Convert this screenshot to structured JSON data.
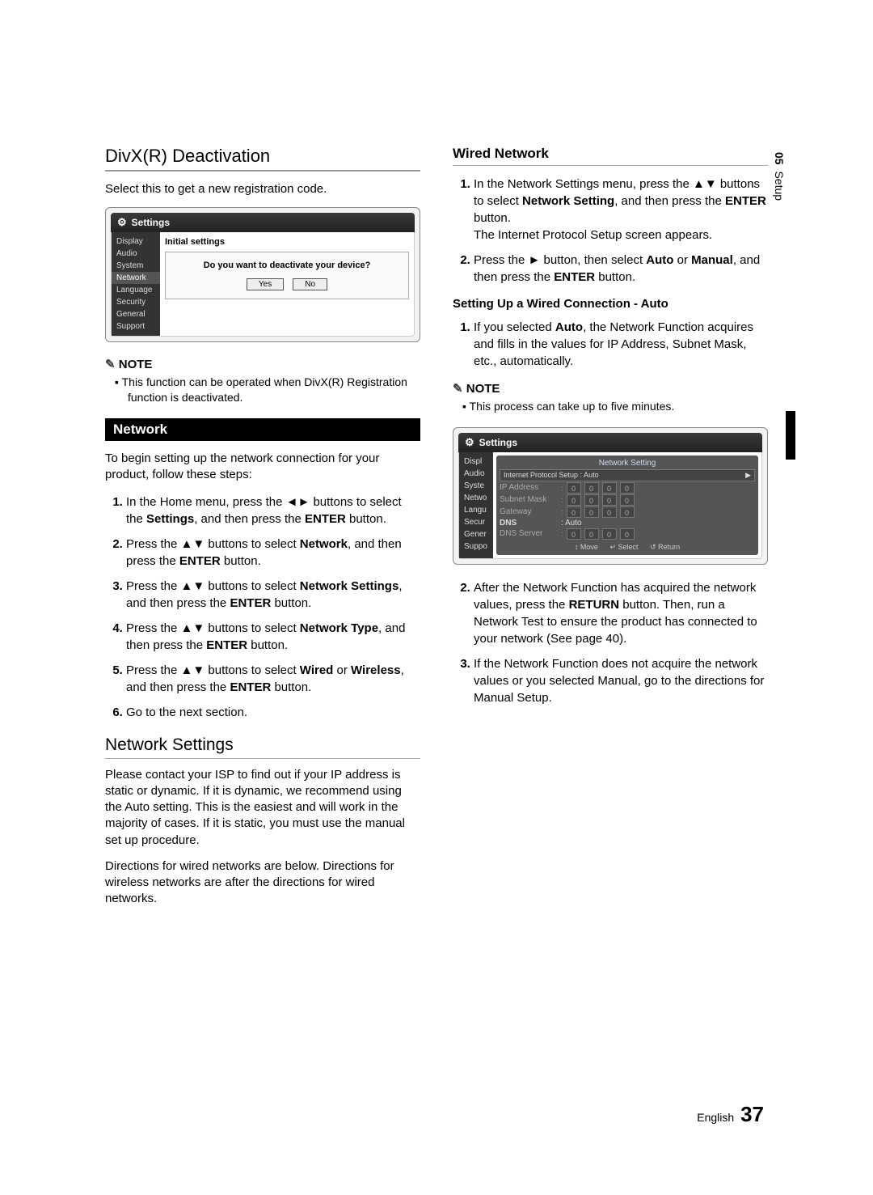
{
  "sideTab": {
    "chapter": "05",
    "label": "Setup"
  },
  "footer": {
    "lang": "English",
    "page": "37"
  },
  "left": {
    "h1": "DivX(R) Deactivation",
    "intro": "Select this to get a new registration code.",
    "shot1": {
      "title": "Settings",
      "menu": [
        "Display",
        "Audio",
        "System",
        "Network",
        "Language",
        "Security",
        "General",
        "Support"
      ],
      "mainTitle": "Initial settings",
      "dialogQ": "Do you want to deactivate your device?",
      "yes": "Yes",
      "no": "No"
    },
    "noteHead": "NOTE",
    "noteItem": "This function can be operated when DivX(R) Registration function is deactivated.",
    "networkBar": "Network",
    "networkIntro": "To begin setting up the network connection for your product, follow these steps:",
    "steps": [
      "In the Home menu, press the ◄► buttons to select the <strong>Settings</strong>, and then press the <strong>ENTER</strong> button.",
      "Press the ▲▼ buttons to select <strong>Network</strong>, and then press the <strong>ENTER</strong> button.",
      "Press the ▲▼ buttons to select <strong>Network Settings</strong>, and then press the <strong>ENTER</strong> button.",
      "Press the ▲▼ buttons to select <strong>Network Type</strong>, and then press the <strong>ENTER</strong> button.",
      "Press the ▲▼ buttons to select <strong>Wired</strong> or <strong>Wireless</strong>, and then press the <strong>ENTER</strong> button.",
      "Go to the next section."
    ],
    "h2": "Network Settings",
    "ns1": "Please contact your ISP to find out if your IP address is static or dynamic. If it is dynamic, we recommend using the Auto setting. This is the easiest and will work in the majority of cases. If it is static, you must use the manual set up procedure.",
    "ns2": "Directions for wired networks are below. Directions for wireless networks are after the directions for wired networks."
  },
  "right": {
    "wired": "Wired Network",
    "steps1": [
      "In the Network Settings menu, press the ▲▼ buttons to select <strong>Network Setting</strong>, and then press the <strong>ENTER</strong> button.<br>The Internet Protocol Setup screen appears.",
      "Press the ► button, then select <strong>Auto</strong> or <strong>Manual</strong>, and then press the <strong>ENTER</strong> button."
    ],
    "h4": "Setting Up a Wired Connection - Auto",
    "steps2_1": "If you selected <strong>Auto</strong>, the Network Function acquires and fills in the values for IP Address, Subnet Mask, etc., automatically.",
    "noteHead": "NOTE",
    "noteItem": "This process can take up to five minutes.",
    "shot2": {
      "title": "Settings",
      "menu": [
        "Display",
        "Audio",
        "System",
        "Network",
        "Language",
        "Security",
        "General",
        "Support"
      ],
      "panelTitle": "Network Setting",
      "ipsLabel": "Internet Protocol Setup : Auto",
      "rows": [
        {
          "label": "IP Address",
          "vals": [
            "0",
            "0",
            "0",
            "0"
          ]
        },
        {
          "label": "Subnet Mask",
          "vals": [
            "0",
            "0",
            "0",
            "0"
          ]
        },
        {
          "label": "Gateway",
          "vals": [
            "0",
            "0",
            "0",
            "0"
          ]
        }
      ],
      "dnsLabel": "DNS",
      "dnsVal": ": Auto",
      "dnsServer": {
        "label": "DNS Server",
        "vals": [
          "0",
          "0",
          "0",
          "0"
        ]
      },
      "btns": {
        "move": "�� Move",
        "select": "↵ Select",
        "return": "↺ Return"
      }
    },
    "steps3": [
      "After the Network Function has acquired the network values, press the <strong>RETURN</strong> button. Then, run a Network Test to ensure the product has connected to your network (See page 40).",
      "If the Network Function does not acquire the network values or you selected Manual, go to the directions for Manual Setup."
    ]
  }
}
